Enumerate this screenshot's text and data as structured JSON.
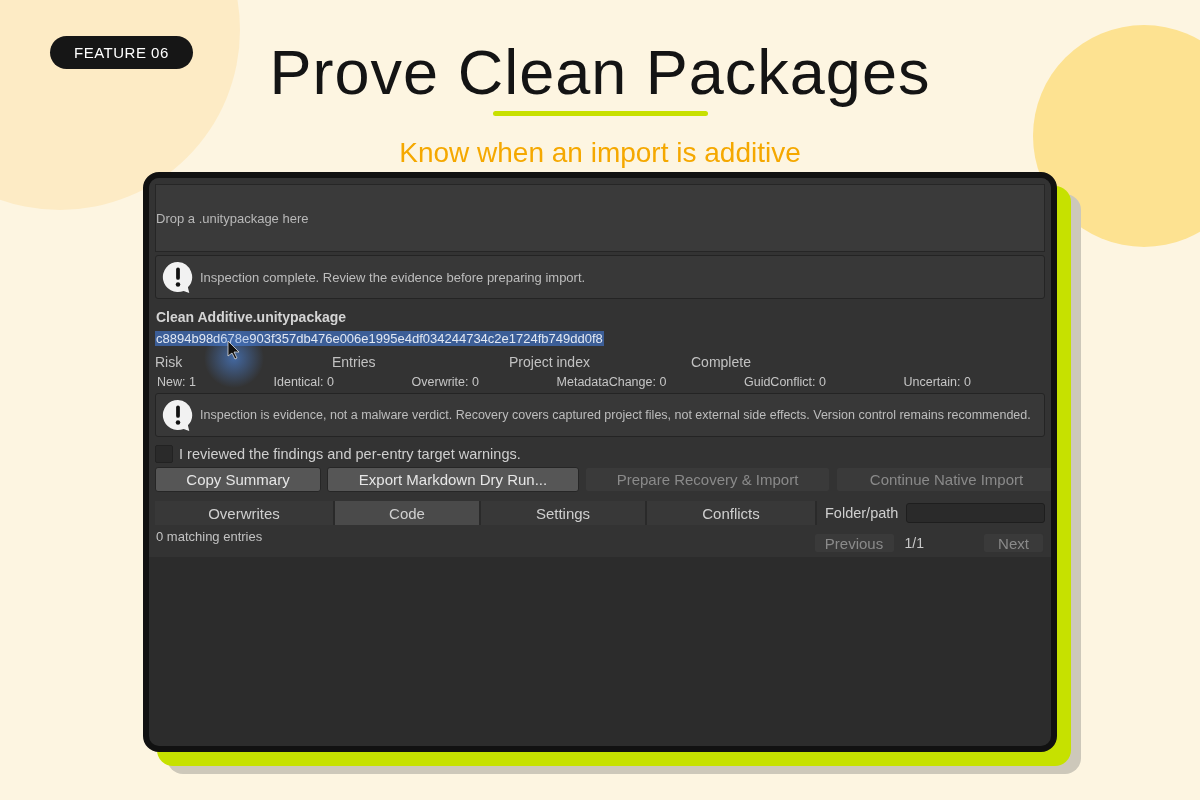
{
  "badge": "FEATURE 06",
  "title": "Prove Clean Packages",
  "subtitle": "Know when an import is additive",
  "window": {
    "drop_zone": "Drop a .unitypackage here",
    "status_message": "Inspection complete. Review the evidence before preparing import.",
    "package_name": "Clean Additive.unitypackage",
    "hash": {
      "text": "c8894b98d678e903f357db476e006e1995e4df034244734c2e1724fb749dd0f8",
      "selected": true
    },
    "summary_headers": [
      "Risk",
      "Entries",
      "Project index",
      "Complete"
    ],
    "counts": [
      "New: 1",
      "Identical: 0",
      "Overwrite: 0",
      "MetadataChange: 0",
      "GuidConflict: 0",
      "Uncertain: 0"
    ],
    "notice": "Inspection is evidence, not a malware verdict. Recovery covers captured project files, not external side effects. Version control remains recommended.",
    "review_checkbox": {
      "label": "I reviewed the findings and per-entry target warnings.",
      "checked": false
    },
    "actions": [
      {
        "label": "Copy Summary",
        "disabled": false
      },
      {
        "label": "Export Markdown Dry Run...",
        "disabled": false
      },
      {
        "label": "Prepare Recovery & Import",
        "disabled": true
      },
      {
        "label": "Continue Native Import",
        "disabled": true
      }
    ],
    "filter_tabs": [
      {
        "label": "Overwrites",
        "selected": false
      },
      {
        "label": "Code",
        "selected": true
      },
      {
        "label": "Settings",
        "selected": false
      },
      {
        "label": "Conflicts",
        "selected": false
      }
    ],
    "folder_filter": {
      "label": "Folder/path"
    },
    "match_count": "0 matching entries",
    "pager": {
      "previous": {
        "label": "Previous",
        "disabled": true
      },
      "page": "1/1",
      "next": {
        "label": "Next",
        "disabled": true
      }
    }
  }
}
